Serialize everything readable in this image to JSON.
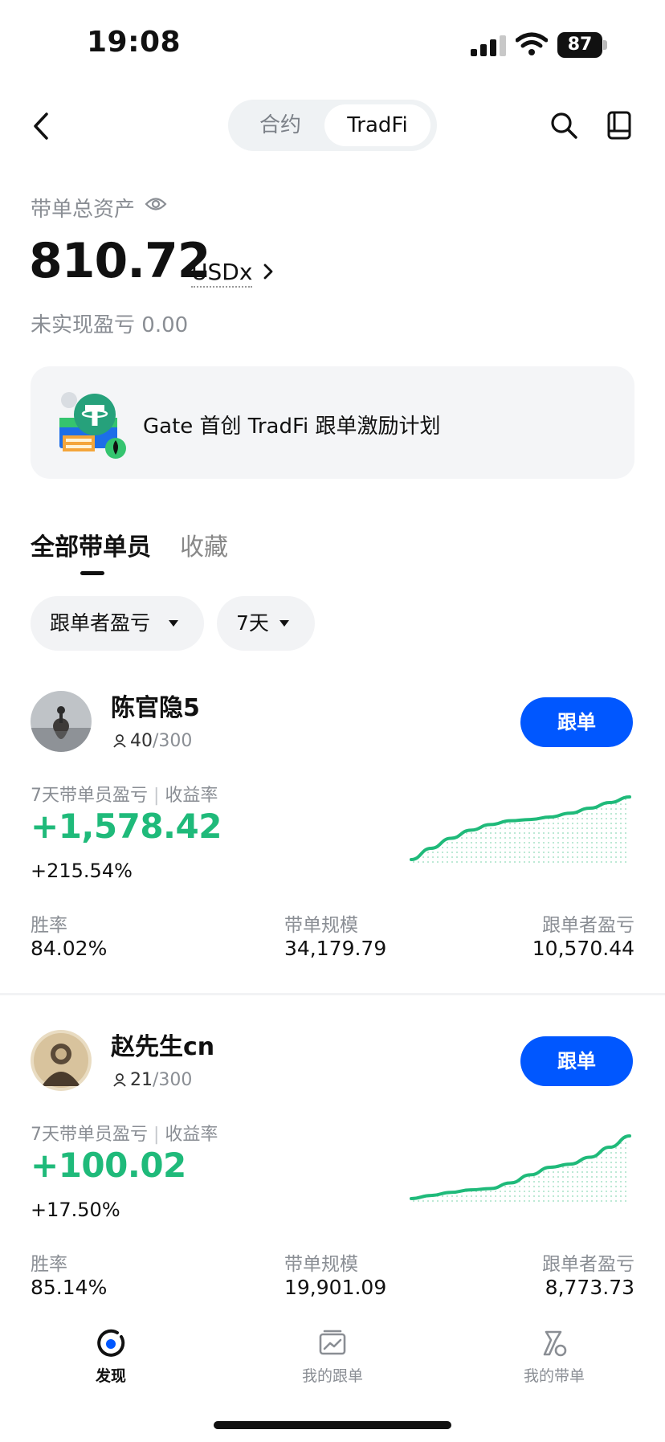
{
  "status_bar": {
    "time": "19:08",
    "battery": "87"
  },
  "header": {
    "segments": [
      {
        "label": "合约"
      },
      {
        "label": "TradFi"
      }
    ],
    "active_segment": "TradFi"
  },
  "assets": {
    "label": "带单总资产",
    "value": "810.72",
    "unit": "USDx",
    "unrealized_label": "未实现盈亏",
    "unrealized_value": "0.00"
  },
  "banner": {
    "text": "Gate 首创 TradFi 跟单激励计划"
  },
  "tabs": [
    {
      "label": "全部带单员"
    },
    {
      "label": "收藏"
    }
  ],
  "filters": [
    {
      "label": "跟单者盈亏"
    },
    {
      "label": "7天"
    }
  ],
  "traders": [
    {
      "name": "陈官隐5",
      "followers": "40",
      "capacity": "/300",
      "follow_label": "跟单",
      "metric_label": "7天带单员盈亏",
      "metric_label2": "收益率",
      "pnl": "+1,578.42",
      "rate": "+215.54%",
      "sparkline": [
        0.0,
        0.18,
        0.34,
        0.47,
        0.56,
        0.62,
        0.64,
        0.68,
        0.74,
        0.82,
        0.91,
        1.0
      ],
      "stats": [
        {
          "label": "胜率",
          "value": "84.02%"
        },
        {
          "label": "带单规模",
          "value": "34,179.79"
        },
        {
          "label": "跟单者盈亏",
          "value": "10,570.44"
        }
      ]
    },
    {
      "name": "赵先生cn",
      "followers": "21",
      "capacity": "/300",
      "follow_label": "跟单",
      "metric_label": "7天带单员盈亏",
      "metric_label2": "收益率",
      "pnl": "+100.02",
      "rate": "+17.50%",
      "sparkline": [
        0.0,
        0.05,
        0.1,
        0.14,
        0.16,
        0.25,
        0.38,
        0.5,
        0.55,
        0.66,
        0.82,
        1.0
      ],
      "stats": [
        {
          "label": "胜率",
          "value": "85.14%"
        },
        {
          "label": "带单规模",
          "value": "19,901.09"
        },
        {
          "label": "跟单者盈亏",
          "value": "8,773.73"
        }
      ]
    }
  ],
  "bottom_nav": [
    {
      "label": "发现",
      "icon": "discover-icon",
      "active": true
    },
    {
      "label": "我的跟单",
      "icon": "my-copy-icon",
      "active": false
    },
    {
      "label": "我的带单",
      "icon": "my-lead-icon",
      "active": false
    }
  ],
  "colors": {
    "accent": "#0057ff",
    "profit": "#1fba7a",
    "text": "#111111",
    "muted": "#8a8e94"
  }
}
